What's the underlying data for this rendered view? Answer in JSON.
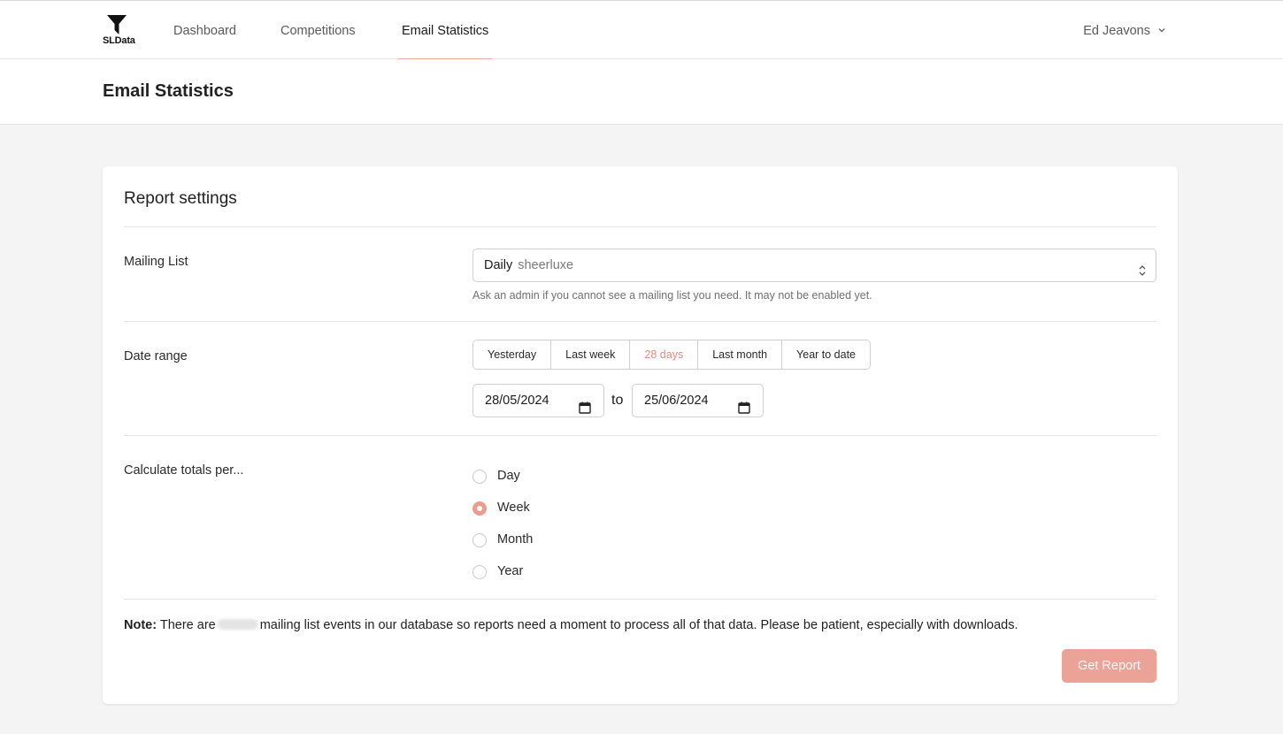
{
  "nav": {
    "brand": "SLData",
    "links": [
      "Dashboard",
      "Competitions",
      "Email Statistics"
    ],
    "active": "Email Statistics",
    "user": "Ed Jeavons"
  },
  "page": {
    "title": "Email Statistics"
  },
  "report": {
    "title": "Report settings",
    "mailing_list": {
      "label": "Mailing List",
      "selected_main": "Daily",
      "selected_sub": "sheerluxe",
      "help": "Ask an admin if you cannot see a mailing list you need. It may not be enabled yet."
    },
    "date_range": {
      "label": "Date range",
      "presets": [
        "Yesterday",
        "Last week",
        "28 days",
        "Last month",
        "Year to date"
      ],
      "active_preset": "28 days",
      "from": "28/05/2024",
      "to_label": "to",
      "to": "25/06/2024"
    },
    "totals": {
      "label": "Calculate totals per...",
      "options": [
        "Day",
        "Week",
        "Month",
        "Year"
      ],
      "selected": "Week"
    },
    "note": {
      "bold": "Note:",
      "before": "There are",
      "after": "mailing list events in our database so reports need a moment to process all of that data. Please be patient, especially with downloads."
    },
    "submit_label": "Get Report"
  },
  "colors": {
    "accent": "#eaa396",
    "accent_text": "#e08b7e",
    "background": "#f4f4f4"
  }
}
